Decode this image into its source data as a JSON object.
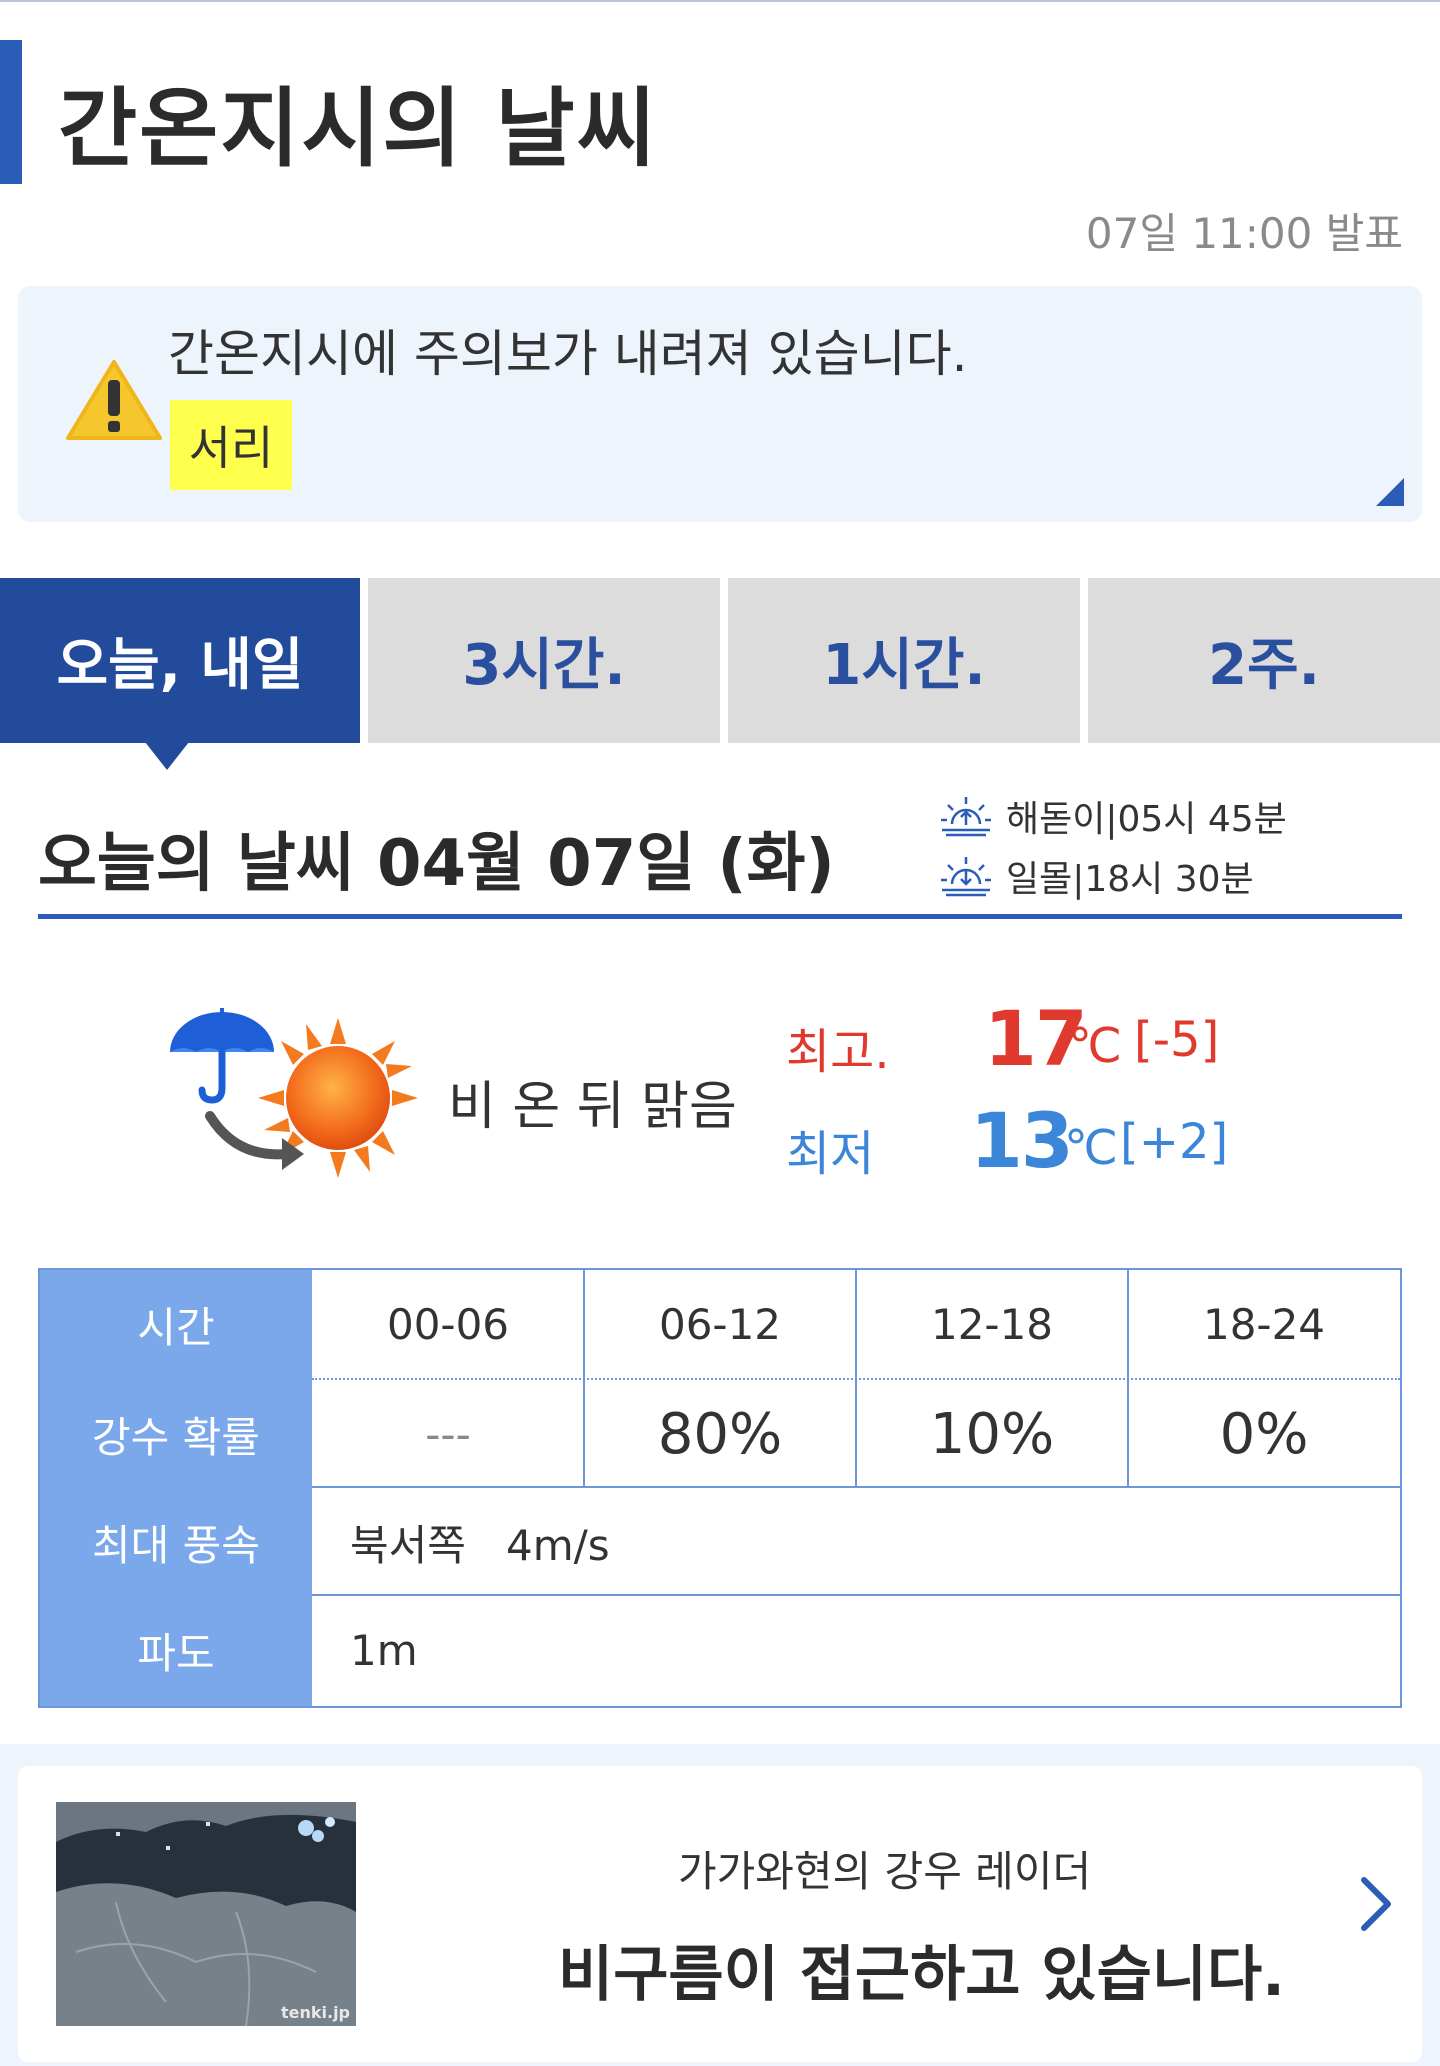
{
  "page": {
    "title": "간온지시의 날씨",
    "announce": "07일 11:00 발표"
  },
  "warning": {
    "icon": "warning-icon",
    "text": "간온지시에 주의보가 내려져 있습니다.",
    "badge": "서리",
    "badge_color": "#ffff4d"
  },
  "tabs": [
    {
      "label": "오늘, 내일",
      "active": true
    },
    {
      "label": "3시간."
    },
    {
      "label": "1시간."
    },
    {
      "label": "2주."
    }
  ],
  "today": {
    "title": "오늘의 날씨 04월 07일  (화)",
    "sunrise": "해돋이|05시 45분",
    "sunset": "일몰|18시 30분"
  },
  "forecast": {
    "icon": "rain-then-sunny-icon",
    "label": "비 온 뒤 맑음",
    "high_label": "최고.",
    "high_value": "17",
    "high_unit": "℃",
    "high_diff": "[-5]",
    "low_label": "최저",
    "low_value": "13",
    "low_unit": "℃",
    "low_diff": "[+2]",
    "high_color": "#e03a2f",
    "low_color": "#3b86d8"
  },
  "table": {
    "headers": [
      "시간",
      "강수 확률",
      "최대 풍속",
      "파도"
    ],
    "times": [
      "00-06",
      "06-12",
      "12-18",
      "18-24"
    ],
    "precip": [
      "---",
      "80%",
      "10%",
      "0%"
    ],
    "wind": "북서쪽   4m/s",
    "wave": "1m"
  },
  "radar": {
    "subtitle": "가가와현의 강우 레이더",
    "message": "비구름이 접근하고 있습니다.",
    "watermark": "tenki.jp"
  },
  "colors": {
    "accent": "#2a5cb8",
    "tab_active": "#234b9c",
    "table_header": "#7ba7eb"
  }
}
